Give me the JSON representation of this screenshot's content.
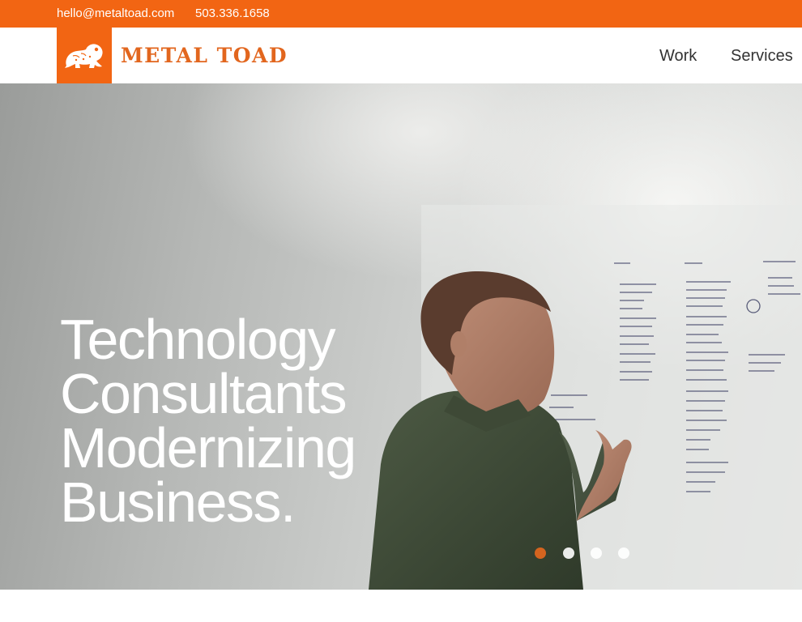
{
  "topbar": {
    "email": "hello@metaltoad.com",
    "phone": "503.336.1658"
  },
  "header": {
    "logo_text": "METAL TOAD",
    "logo_icon": "toad-icon",
    "nav": [
      {
        "label": "Work"
      },
      {
        "label": "Services"
      }
    ]
  },
  "hero": {
    "title_lines": [
      "Technology",
      "Consultants",
      "Modernizing",
      "Business."
    ],
    "slides": {
      "count": 4,
      "active": 1
    }
  },
  "colors": {
    "brand_orange": "#f26513",
    "logo_text": "#e2661e",
    "active_dot": "#d4641f"
  }
}
